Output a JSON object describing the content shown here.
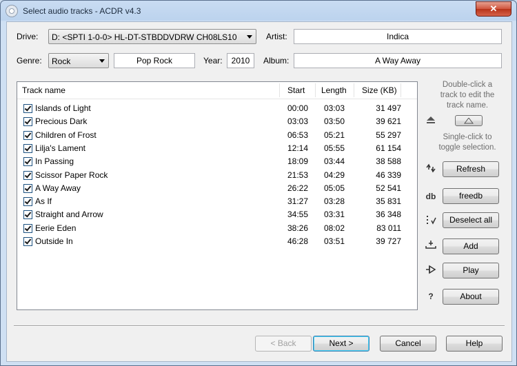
{
  "window": {
    "title": "Select audio tracks - ACDR v4.3",
    "close_label": "✕"
  },
  "drive": {
    "label": "Drive:",
    "value": "D: <SPTI 1-0-0> HL-DT-STBDDVDRW CH08LS10"
  },
  "artist": {
    "label": "Artist:",
    "value": "Indica"
  },
  "genre": {
    "label": "Genre:",
    "value": "Rock",
    "text": "Pop Rock"
  },
  "year": {
    "label": "Year:",
    "value": "2010"
  },
  "album": {
    "label": "Album:",
    "value": "A Way Away"
  },
  "tracklist": {
    "columns": {
      "name": "Track name",
      "start": "Start",
      "length": "Length",
      "size": "Size (KB)"
    },
    "rows": [
      {
        "name": "Islands of Light",
        "start": "00:00",
        "length": "03:03",
        "size": "31 497",
        "checked": true
      },
      {
        "name": "Precious Dark",
        "start": "03:03",
        "length": "03:50",
        "size": "39 621",
        "checked": true
      },
      {
        "name": "Children of Frost",
        "start": "06:53",
        "length": "05:21",
        "size": "55 297",
        "checked": true
      },
      {
        "name": "Lilja's Lament",
        "start": "12:14",
        "length": "05:55",
        "size": "61 154",
        "checked": true
      },
      {
        "name": "In Passing",
        "start": "18:09",
        "length": "03:44",
        "size": "38 588",
        "checked": true
      },
      {
        "name": "Scissor Paper Rock",
        "start": "21:53",
        "length": "04:29",
        "size": "46 339",
        "checked": true
      },
      {
        "name": "A Way Away",
        "start": "26:22",
        "length": "05:05",
        "size": "52 541",
        "checked": true
      },
      {
        "name": "As If",
        "start": "31:27",
        "length": "03:28",
        "size": "35 831",
        "checked": true
      },
      {
        "name": "Straight and Arrow",
        "start": "34:55",
        "length": "03:31",
        "size": "36 348",
        "checked": true
      },
      {
        "name": "Eerie Eden",
        "start": "38:26",
        "length": "08:02",
        "size": "83 011",
        "checked": true
      },
      {
        "name": "Outside In",
        "start": "46:28",
        "length": "03:51",
        "size": "39 727",
        "checked": true
      }
    ]
  },
  "sidebar": {
    "hint_edit": [
      "Double-click a",
      "track to edit the",
      "track name."
    ],
    "hint_toggle": [
      "Single-click to",
      "toggle selection."
    ],
    "refresh": "Refresh",
    "freedb": "freedb",
    "freedb_icon_text": "db",
    "deselect_all": "Deselect all",
    "add": "Add",
    "play": "Play",
    "about": "About",
    "about_icon_text": "?"
  },
  "footer": {
    "back": "< Back",
    "next": "Next >",
    "cancel": "Cancel",
    "help": "Help"
  },
  "icons": [
    "app-icon",
    "eject-icon",
    "refresh-icon",
    "freedb-icon",
    "deselect-icon",
    "add-icon",
    "play-icon",
    "about-icon"
  ]
}
